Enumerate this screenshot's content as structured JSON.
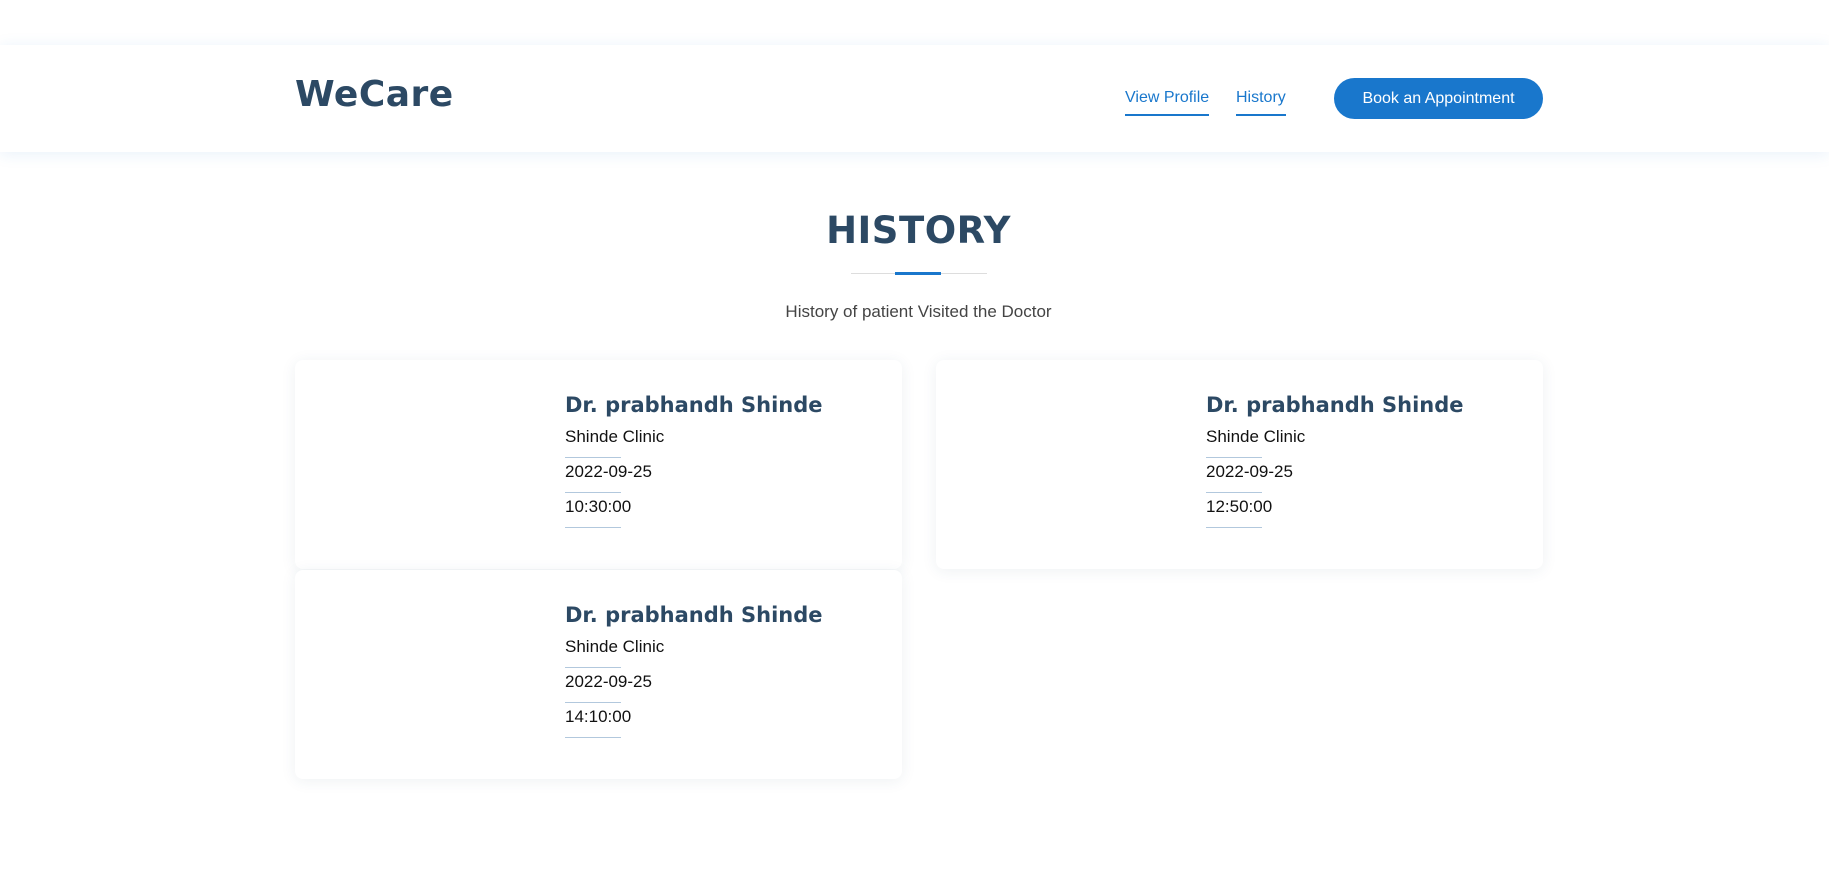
{
  "header": {
    "logo": "WeCare",
    "nav": [
      {
        "label": "View Profile"
      },
      {
        "label": "History"
      }
    ],
    "cta_label": "Book an Appointment"
  },
  "section": {
    "title": "HISTORY",
    "subtitle": "History of patient Visited the Doctor"
  },
  "cards": [
    {
      "doctor": "Dr. prabhandh Shinde",
      "clinic": "Shinde Clinic",
      "date": "2022-09-25",
      "time": "10:30:00"
    },
    {
      "doctor": "Dr. prabhandh Shinde",
      "clinic": "Shinde Clinic",
      "date": "2022-09-25",
      "time": "12:50:00"
    },
    {
      "doctor": "Dr. prabhandh Shinde",
      "clinic": "Shinde Clinic",
      "date": "2022-09-25",
      "time": "14:10:00"
    }
  ],
  "colors": {
    "accent": "#1977cc",
    "heading": "#2c4964",
    "text": "#444444"
  }
}
